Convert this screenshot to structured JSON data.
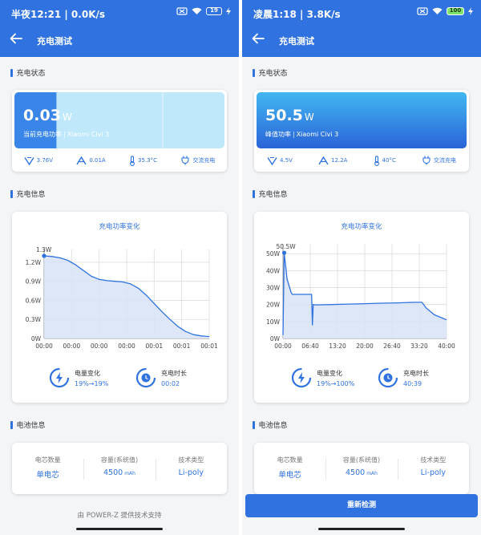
{
  "left": {
    "status_time": "半夜12:21 | 0.0K/s",
    "battery_level": "19",
    "title": "充电测试",
    "section_charge_status": "充电状态",
    "power_value": "0.03",
    "power_unit": "W",
    "power_label": "当前充电功率",
    "device": "Xiaomi Civi 3",
    "power_fill_fraction": 0.2,
    "metrics": {
      "voltage": "3.76V",
      "current": "0.01A",
      "temperature": "35.3°C",
      "charge_type": "交流充电"
    },
    "section_charge_info": "充电信息",
    "chart_title": "充电功率变化",
    "chart_data": {
      "type": "area",
      "title": "充电功率变化",
      "peak_label": "1.3W",
      "y_ticks": [
        "0W",
        "0.3W",
        "0.6W",
        "0.9W",
        "1.2W"
      ],
      "x_ticks": [
        "00:00",
        "00:00",
        "00:00",
        "00:00",
        "00:01",
        "00:01",
        "00:01"
      ],
      "ylim": [
        0,
        1.3
      ],
      "x": [
        0,
        0.3,
        0.6,
        0.9,
        1.2,
        1.5,
        1.8,
        2.1,
        2.4,
        2.7,
        3.0,
        3.3,
        3.6,
        3.9,
        4.2,
        4.5,
        4.8,
        5.1,
        5.4,
        5.7,
        6.0,
        6.3
      ],
      "values": [
        1.3,
        1.29,
        1.27,
        1.23,
        1.16,
        1.07,
        0.98,
        0.93,
        0.91,
        0.9,
        0.89,
        0.86,
        0.79,
        0.68,
        0.55,
        0.42,
        0.3,
        0.19,
        0.11,
        0.06,
        0.04,
        0.03
      ],
      "xlim": [
        0,
        6.3
      ],
      "grid": true
    },
    "stats": {
      "energy_label": "电量变化",
      "energy_value": "19%→19%",
      "duration_label": "充电时长",
      "duration_value": "00:02"
    },
    "section_battery_info": "电池信息",
    "battery_info": {
      "cells_label": "电芯数量",
      "cells_value": "单电芯",
      "capacity_label": "容量(系统值)",
      "capacity_value": "4500",
      "capacity_unit": "mAh",
      "tech_label": "技术类型",
      "tech_value": "Li-poly"
    },
    "footer": "由 POWER-Z 提供技术支持"
  },
  "right": {
    "status_time": "凌晨1:18 | 3.8K/s",
    "battery_level": "100",
    "title": "充电测试",
    "section_charge_status": "充电状态",
    "power_value": "50.5",
    "power_unit": "W",
    "power_label": "峰值功率",
    "device": "Xiaomi Civi 3",
    "power_fill_fraction": 1.0,
    "metrics": {
      "voltage": "4.5V",
      "current": "12.2A",
      "temperature": "40°C",
      "charge_type": "交流充电"
    },
    "section_charge_info": "充电信息",
    "chart_title": "充电功率变化",
    "chart_data": {
      "type": "area",
      "title": "充电功率变化",
      "peak_label": "50.5W",
      "y_ticks": [
        "0W",
        "10W",
        "20W",
        "30W",
        "40W",
        "50W"
      ],
      "x_ticks": [
        "00:00",
        "06:40",
        "13:20",
        "20:00",
        "26:40",
        "33:20",
        "40:00"
      ],
      "ylim": [
        0,
        52
      ],
      "x": [
        0,
        0.3,
        1.0,
        2.0,
        2.3,
        5.0,
        7.0,
        7.2,
        7.4,
        8.0,
        12,
        16,
        20,
        24,
        28,
        32,
        34,
        35,
        37,
        39,
        40
      ],
      "values": [
        2,
        50.5,
        35,
        27,
        26,
        26,
        26,
        8,
        20,
        19.8,
        20,
        20.3,
        20.5,
        20.8,
        21,
        21.3,
        21.3,
        18,
        14,
        12,
        11
      ],
      "xlim": [
        0,
        40
      ],
      "grid": true
    },
    "stats": {
      "energy_label": "电量变化",
      "energy_value": "19%→100%",
      "duration_label": "充电时长",
      "duration_value": "40:39"
    },
    "section_battery_info": "电池信息",
    "battery_info": {
      "cells_label": "电芯数量",
      "cells_value": "单电芯",
      "capacity_label": "容量(系统值)",
      "capacity_value": "4500",
      "capacity_unit": "mAh",
      "tech_label": "技术类型",
      "tech_value": "Li-poly"
    },
    "retest_label": "重新检测"
  },
  "colors": {
    "primary": "#2f72e0",
    "banner_light": "#bfe8fb",
    "banner_top": "#3fb4f0",
    "chart_fill": "#d7e3f7"
  }
}
